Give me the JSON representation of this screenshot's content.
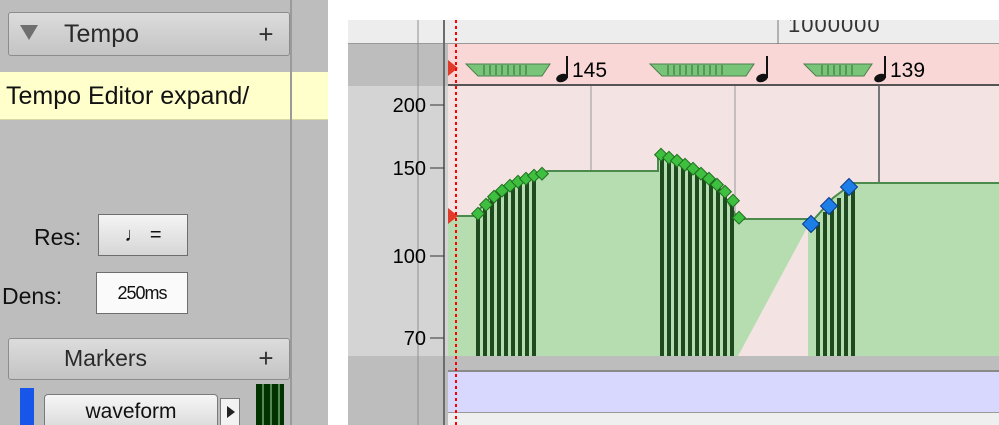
{
  "left_panel": {
    "tempo_title": "Tempo",
    "tempo_plus": "+",
    "tooltip": "Tempo Editor expand/",
    "res_label": "Res:",
    "res_value": "♩ =",
    "dens_label": "Dens:",
    "dens_value": "250ms",
    "markers_title": "Markers",
    "markers_plus": "+",
    "waveform_label": "waveform"
  },
  "right_panel": {
    "ruler_text": "1000000",
    "tempo_markers": [
      "145",
      "",
      "139"
    ],
    "y_ticks": [
      "200",
      "150",
      "100",
      "70"
    ]
  },
  "colors": {
    "tempo_lane": "#f9d7d7",
    "graph_fill": "#b5ddb0",
    "bar_dark": "#225522",
    "point_green": "#3fbf3f",
    "point_blue": "#1e7ee8",
    "playhead": "#ff0000"
  }
}
